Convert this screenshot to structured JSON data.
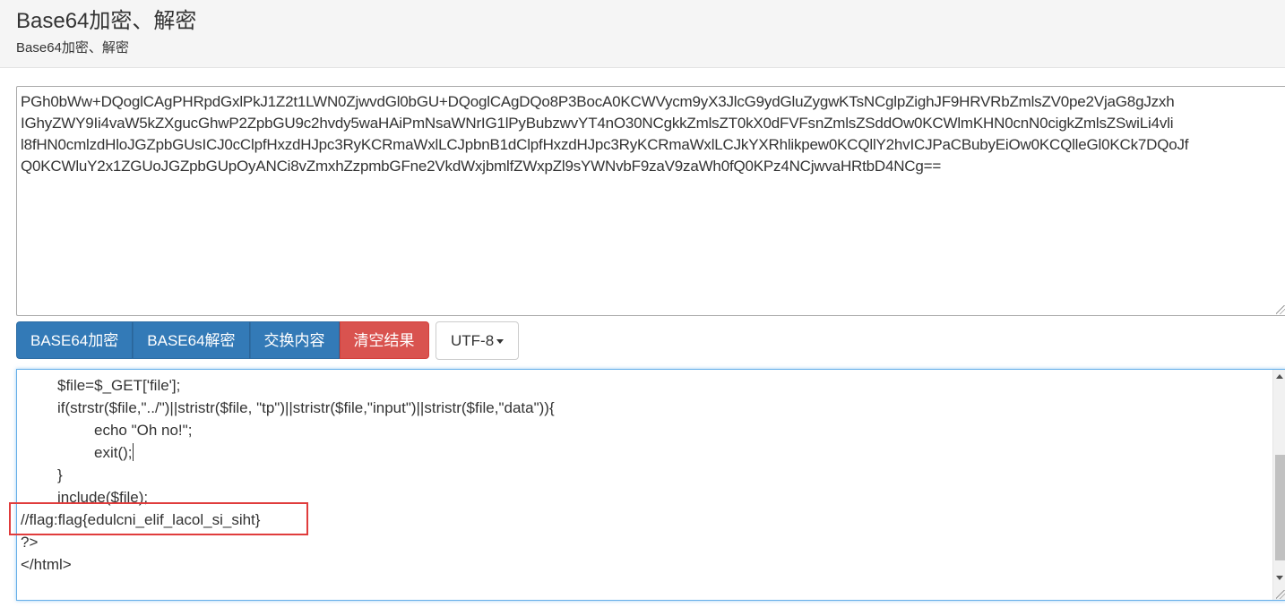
{
  "header": {
    "title": "Base64加密、解密",
    "subtitle": "Base64加密、解密"
  },
  "input": {
    "lines": [
      "PGh0bWw+DQoglCAgPHRpdGxlPkJ1Z2t1LWN0ZjwvdGl0bGU+DQoglCAgDQo8P3BocA0KCWVycm9yX3JlcG9ydGluZygwKTsNCglpZighJF9HRVRbZmlsZV0pe2VjaG8gJzxh",
      "IGhyZWY9Ii4vaW5kZXgucGhwP2ZpbGU9c2hvdy5waHAiPmNsaWNrIG1lPyBubzwvYT4nO30NCgkkZmlsZT0kX0dFVFsnZmlsZSddOw0KCWlmKHN0cnN0cigkZmlsZSwiLi4vli",
      "l8fHN0cmlzdHloJGZpbGUsICJ0cClpfHxzdHJpc3RyKCRmaWxlLCJpbnB1dClpfHxzdHJpc3RyKCRmaWxlLCJkYXRhlikpew0KCQllY2hvICJPaCBubyEiOw0KCQlleGl0KCk7DQoJf",
      "Q0KCWluY2x1ZGUoJGZpbGUpOyANCi8vZmxhZzpmbGFne2VkdWxjbmlfZWxpZl9sYWNvbF9zaV9zaWh0fQ0KPz4NCjwvaHRtbD4NCg=="
    ]
  },
  "buttons": {
    "encode": "BASE64加密",
    "decode": "BASE64解密",
    "swap": "交换内容",
    "clear": "清空结果",
    "charset": "UTF-8"
  },
  "output": {
    "lines": [
      "\t$file=$_GET['file'];",
      "\tif(strstr($file,\"../\")||stristr($file, \"tp\")||stristr($file,\"input\")||stristr($file,\"data\")){",
      "\t\techo \"Oh no!\";",
      "\t\texit();",
      "\t}",
      "\tinclude($file);",
      "//flag:flag{edulcni_elif_lacol_si_siht}",
      "?>",
      "</html>"
    ]
  },
  "colors": {
    "primary": "#337ab7",
    "danger": "#d9534f",
    "highlight": "#e03c3c",
    "focus": "#66afe9"
  }
}
